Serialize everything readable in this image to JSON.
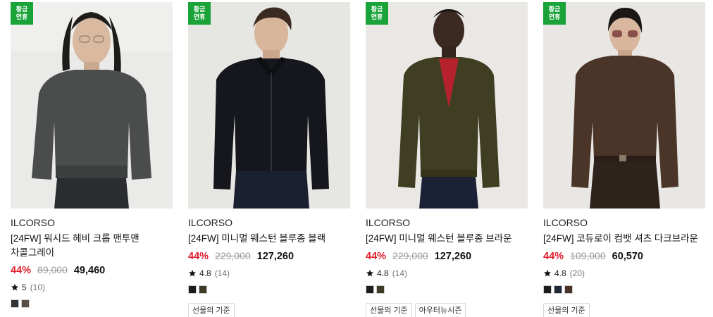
{
  "products": [
    {
      "badge": "황금\n연휴",
      "brand": "ILCORSO",
      "title": "[24FW] 워시드 헤비 크롭 맨투맨 차콜그레이",
      "discount": "44%",
      "original_price": "89,000",
      "price": "49,460",
      "rating": "5",
      "review_count": "(10)",
      "colors": [
        "#2f3236",
        "#5a4e48"
      ],
      "tags": []
    },
    {
      "badge": "황금\n연휴",
      "brand": "ILCORSO",
      "title": "[24FW] 미니멀 웨스턴 블루종 블랙",
      "discount": "44%",
      "original_price": "229,000",
      "price": "127,260",
      "rating": "4.8",
      "review_count": "(14)",
      "colors": [
        "#1c1c1c",
        "#3d3a26"
      ],
      "tags": [
        "선물의 기준"
      ]
    },
    {
      "badge": "황금\n연휴",
      "brand": "ILCORSO",
      "title": "[24FW] 미니멀 웨스턴 블루종 브라운",
      "discount": "44%",
      "original_price": "229,000",
      "price": "127,260",
      "rating": "4.8",
      "review_count": "(14)",
      "colors": [
        "#1c1c1c",
        "#3d3a26"
      ],
      "tags": [
        "선물의 기준",
        "아우터뉴시즌"
      ]
    },
    {
      "badge": "황금\n연휴",
      "brand": "ILCORSO",
      "title": "[24FW] 코듀로이 컴뱃 셔츠 다크브라운",
      "discount": "44%",
      "original_price": "109,000",
      "price": "60,570",
      "rating": "4.8",
      "review_count": "(20)",
      "colors": [
        "#1c1c1c",
        "#1e2638",
        "#4a3328"
      ],
      "tags": [
        "선물의 기준"
      ]
    }
  ],
  "icons": {
    "star": "star-icon"
  }
}
